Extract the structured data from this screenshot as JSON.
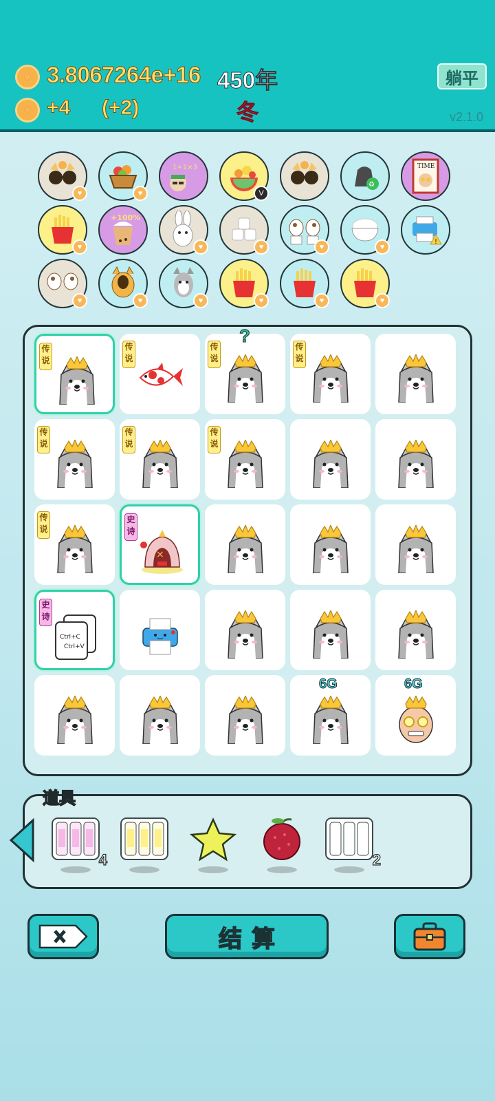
{
  "header": {
    "coins": "3.8067264e+16",
    "year": "450年",
    "income": "+4",
    "income_bonus": "(+2)",
    "season": "冬",
    "lay_flat_label": "躺平",
    "version": "v2.1.0"
  },
  "collection": {
    "badges": [
      {
        "label": "",
        "icon": "sunglasses-dog"
      },
      {
        "label": "",
        "icon": "fruit-basket"
      },
      {
        "label": "1+1×3",
        "icon": "math-guy"
      },
      {
        "label": "V",
        "icon": "fruit-bowl"
      },
      {
        "label": "",
        "icon": "sunglasses-dog"
      },
      {
        "label": "",
        "icon": "trash-bag"
      },
      {
        "label": "TIME",
        "icon": "time-magazine"
      },
      {
        "label": "",
        "icon": "fries"
      },
      {
        "label": "+100%",
        "icon": "milk-tea"
      },
      {
        "label": "",
        "icon": "bunny"
      },
      {
        "label": "",
        "icon": "sugar-cubes"
      },
      {
        "label": "",
        "icon": "cows"
      },
      {
        "label": "",
        "icon": "rice-bowl"
      },
      {
        "label": "",
        "icon": "printer-warning"
      },
      {
        "label": "",
        "icon": "cows"
      },
      {
        "label": "",
        "icon": "cat"
      },
      {
        "label": "",
        "icon": "husky"
      },
      {
        "label": "",
        "icon": "fries"
      },
      {
        "label": "",
        "icon": "fries"
      },
      {
        "label": "",
        "icon": "fries"
      }
    ]
  },
  "board": {
    "legend_tag": "传说",
    "epic_tag": "史诗",
    "question_mark": "?",
    "six_g": "6G",
    "copy_label": "Ctrl+C",
    "paste_label": "Ctrl+V",
    "tiles": [
      {
        "type": "husky",
        "tag": "legend",
        "selected": true
      },
      {
        "type": "koi",
        "tag": "legend"
      },
      {
        "type": "husky",
        "tag": "legend",
        "mark": "question"
      },
      {
        "type": "husky",
        "tag": "legend"
      },
      {
        "type": "husky"
      },
      {
        "type": "husky",
        "tag": "legend"
      },
      {
        "type": "husky",
        "tag": "legend"
      },
      {
        "type": "husky",
        "tag": "legend"
      },
      {
        "type": "husky"
      },
      {
        "type": "husky"
      },
      {
        "type": "husky",
        "tag": "legend"
      },
      {
        "type": "temple",
        "tag": "epic",
        "selected": true
      },
      {
        "type": "husky"
      },
      {
        "type": "husky"
      },
      {
        "type": "husky"
      },
      {
        "type": "copy-paste",
        "tag": "epic",
        "selected": true
      },
      {
        "type": "printer"
      },
      {
        "type": "husky"
      },
      {
        "type": "husky"
      },
      {
        "type": "husky"
      },
      {
        "type": "husky"
      },
      {
        "type": "husky"
      },
      {
        "type": "husky"
      },
      {
        "type": "husky",
        "mark": "6g"
      },
      {
        "type": "bald-man",
        "mark": "6g"
      }
    ]
  },
  "items": {
    "label": "道具",
    "list": [
      {
        "name": "epic-cards",
        "count": "4"
      },
      {
        "name": "legend-cards",
        "count": ""
      },
      {
        "name": "star",
        "count": ""
      },
      {
        "name": "bayberry",
        "count": ""
      },
      {
        "name": "empty-cards",
        "count": "2"
      }
    ]
  },
  "buttons": {
    "settle_label": "结算"
  },
  "colors": {
    "header_bg": "#17c3c1",
    "button_teal": "#2cc7c7",
    "legend_yellow": "#fff08a",
    "epic_pink": "#f6b9e7"
  }
}
